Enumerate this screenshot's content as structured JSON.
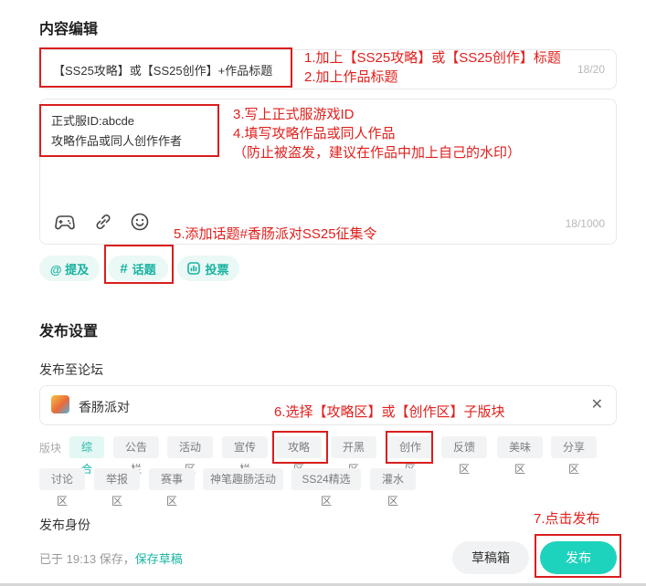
{
  "content_section": {
    "title": "内容编辑",
    "title_field": {
      "value": "【SS25攻略】或【SS25创作】+作品标题",
      "counter": "18/20"
    },
    "body_field": {
      "lines": [
        "正式服ID:abcde",
        "攻略作品或同人创作作者"
      ],
      "counter": "18/1000"
    },
    "toolbar_icons": [
      "gamepad-icon",
      "link-icon",
      "emoji-icon"
    ],
    "chips": {
      "mention": "@ 提及",
      "topic": "话题",
      "vote": "投票"
    }
  },
  "annotations": {
    "note1": "1.加上【SS25攻略】或【SS25创作】标题",
    "note2": "2.加上作品标题",
    "note3": "3.写上正式服游戏ID",
    "note4": "4.填写攻略作品或同人作品",
    "note4b": "（防止被盗发，建议在作品中加上自己的水印）",
    "note5": "5.添加话题#香肠派对SS25征集令",
    "note6": "6.选择【攻略区】或【创作区】子版块",
    "note7": "7.点击发布"
  },
  "publish_section": {
    "title": "发布设置",
    "forum_label": "发布至论坛",
    "forum_name": "香肠派对",
    "board_label": "版块",
    "boards_row1": [
      "综合",
      "公告栏",
      "活动区",
      "宣传栏",
      "攻略区",
      "开黑区",
      "创作区",
      "反馈区",
      "美味区",
      "分享区"
    ],
    "boards_row2": [
      "讨论区",
      "举报区",
      "赛事区",
      "神笔趣肠活动",
      "SS24精选区",
      "灌水区"
    ],
    "selected_board": "综合",
    "identity_label": "发布身份",
    "saved_text": "已于 19:13 保存，",
    "save_draft_link": "保存草稿",
    "draft_box_button": "草稿箱",
    "publish_button": "发布"
  },
  "colors": {
    "accent": "#1ab5a2",
    "publish_btn": "#1ed3bd",
    "annotation_red": "#e0201d"
  }
}
